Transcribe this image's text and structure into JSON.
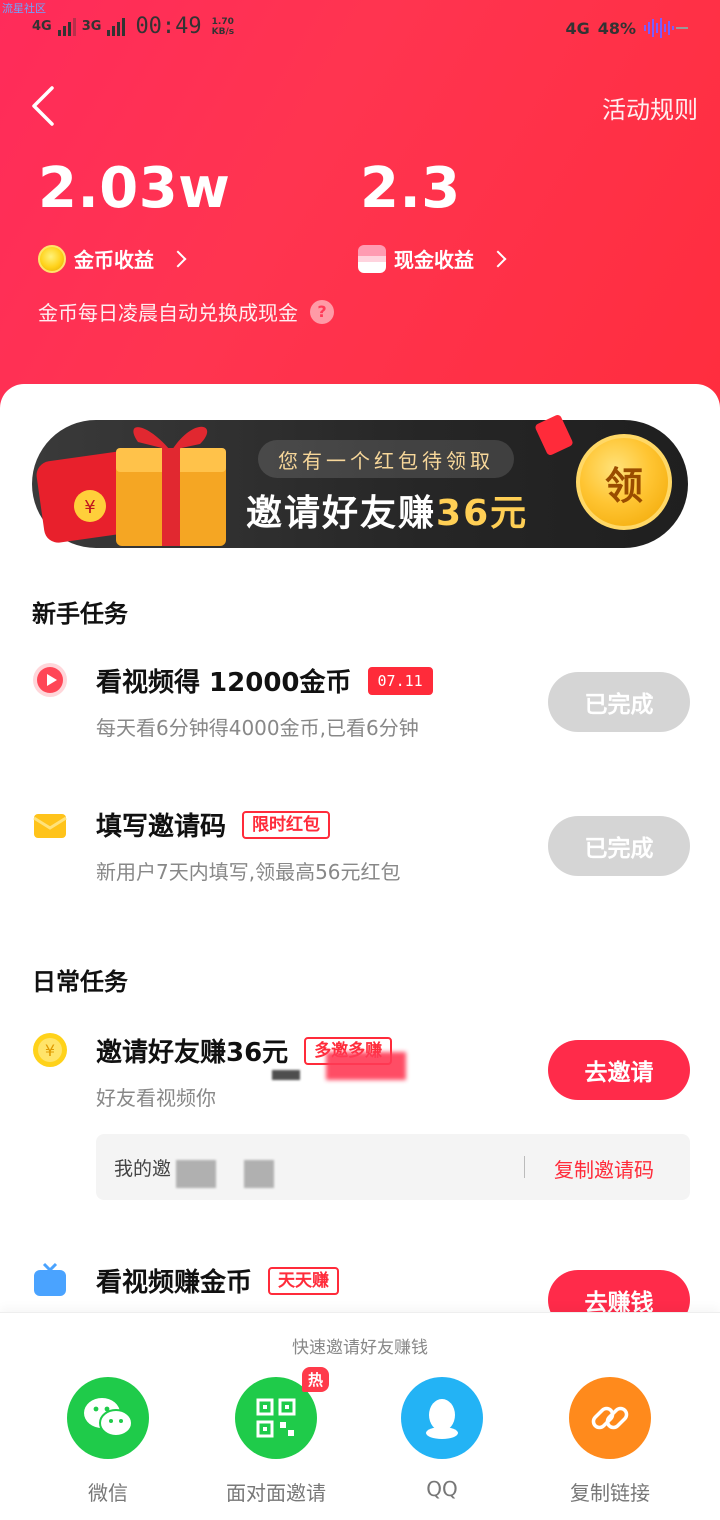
{
  "watermark": "流星社区",
  "status_bar": {
    "net1": "4G",
    "net2": "3G",
    "time": "00:49",
    "speed_top": "1.70",
    "speed_bottom": "KB/s",
    "net_right": "4G",
    "battery": "48%"
  },
  "header": {
    "rules_label": "活动规则",
    "coin_value": "2.03w",
    "cash_value": "2.3",
    "coin_label": "金币收益",
    "cash_label": "现金收益",
    "tip": "金币每日凌晨自动兑换成现金",
    "tip_icon": "?"
  },
  "banner": {
    "pill": "您有一个红包待领取",
    "main": "邀请好友赚",
    "amount": "36元",
    "claim": "领"
  },
  "sections": {
    "newbie": "新手任务",
    "daily": "日常任务"
  },
  "tasks": [
    {
      "title": "看视频得 12000金币",
      "tag": "07.11",
      "desc": "每天看6分钟得4000金币,已看6分钟",
      "button": "已完成"
    },
    {
      "title": "填写邀请码",
      "tag": "限时红包",
      "desc": "新用户7天内填写,领最高56元红包",
      "button": "已完成"
    },
    {
      "title": "邀请好友赚36元",
      "tag": "多邀多赚",
      "desc": "好友看视频你",
      "button": "去邀请"
    },
    {
      "title": "看视频赚金币",
      "tag": "天天赚",
      "desc": "",
      "button": "去赚钱"
    }
  ],
  "invite": {
    "label": "我的邀",
    "copy": "复制邀请码"
  },
  "share": {
    "title": "快速邀请好友赚钱",
    "hot": "热",
    "items": [
      {
        "label": "微信",
        "color": "#1fcb4a"
      },
      {
        "label": "面对面邀请",
        "color": "#1fcb4a"
      },
      {
        "label": "QQ",
        "color": "#23b3f5"
      },
      {
        "label": "复制链接",
        "color": "#ff8a1c"
      }
    ]
  }
}
